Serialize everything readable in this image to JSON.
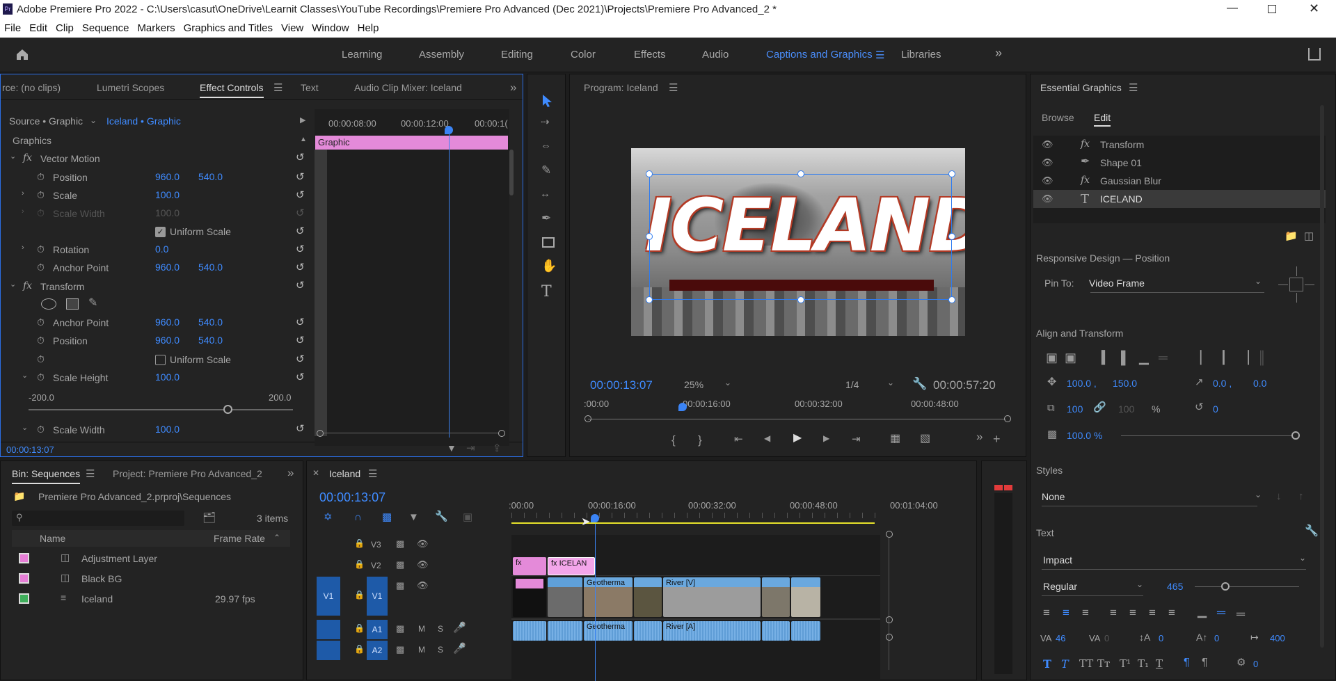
{
  "window": {
    "title": "Adobe Premiere Pro 2022 - C:\\Users\\casut\\OneDrive\\Learnit Classes\\YouTube Recordings\\Premiere Pro Advanced (Dec 2021)\\Projects\\Premiere Pro Advanced_2 *",
    "app_icon": "Pr"
  },
  "menu": [
    "File",
    "Edit",
    "Clip",
    "Sequence",
    "Markers",
    "Graphics and Titles",
    "View",
    "Window",
    "Help"
  ],
  "workspaces": [
    "Learning",
    "Assembly",
    "Editing",
    "Color",
    "Effects",
    "Audio",
    "Captions and Graphics",
    "Libraries"
  ],
  "active_workspace": "Captions and Graphics",
  "effect_panel": {
    "tabs": [
      "rce: (no clips)",
      "Lumetri Scopes",
      "Effect Controls",
      "Text",
      "Audio Clip Mixer: Iceland"
    ],
    "source": "Source • Graphic",
    "target": "Iceland • Graphic",
    "section": "Graphics",
    "tc_ruler": [
      "00:00:08:00",
      "00:00:12:00",
      "00:00:1("
    ],
    "clip_label": "Graphic",
    "vector_motion": "Vector Motion",
    "rows": [
      {
        "label": "Position",
        "v1": "960.0",
        "v2": "540.0"
      },
      {
        "label": "Scale",
        "v1": "100.0"
      },
      {
        "label": "Scale Width",
        "v1": "100.0"
      },
      {
        "label": "Uniform Scale"
      },
      {
        "label": "Rotation",
        "v1": "0.0"
      },
      {
        "label": "Anchor Point",
        "v1": "960.0",
        "v2": "540.0"
      }
    ],
    "transform": "Transform",
    "t_rows": [
      {
        "label": "Anchor Point",
        "v1": "960.0",
        "v2": "540.0"
      },
      {
        "label": "Position",
        "v1": "960.0",
        "v2": "540.0"
      },
      {
        "label": "Uniform Scale"
      },
      {
        "label": "Scale Height",
        "v1": "100.0"
      },
      {
        "label": "Scale Width",
        "v1": "100.0"
      }
    ],
    "slider_min": "-200.0",
    "slider_max": "200.0",
    "timecode": "00:00:13:07"
  },
  "program": {
    "title": "Program: Iceland",
    "headline": "ICELAND",
    "timecode": "00:00:13:07",
    "zoom": "25%",
    "quality": "1/4",
    "duration": "00:00:57:20",
    "ruler": [
      ":00:00",
      "00:00:16:00",
      "00:00:32:00",
      "00:00:48:00"
    ]
  },
  "tools": [
    "selection",
    "track-select",
    "ripple-edit",
    "razor",
    "slip",
    "pen",
    "rectangle",
    "hand",
    "type"
  ],
  "essential": {
    "title": "Essential Graphics",
    "tabs": [
      "Browse",
      "Edit"
    ],
    "layers": [
      "Transform",
      "Shape 01",
      "Gaussian Blur",
      "ICELAND"
    ],
    "responsive": "Responsive Design — Position",
    "pin_label": "Pin To:",
    "pin_value": "Video Frame",
    "align_title": "Align and Transform",
    "pos_x": "100.0 ,",
    "pos_y": "150.0",
    "anchor_x": "0.0 ,",
    "anchor_y": "0.0",
    "scale": "100",
    "scale2": "100",
    "pct": "%",
    "rotation": "0",
    "opacity": "100.0 %",
    "styles_title": "Styles",
    "style_value": "None",
    "text_title": "Text",
    "font": "Impact",
    "font_style": "Regular",
    "font_size": "465",
    "kerning": "46",
    "tracking": "0",
    "leading": "0",
    "baseline": "0",
    "tsume": "400",
    "tab_width": "0"
  },
  "project": {
    "tabs": [
      "Bin: Sequences",
      "Project: Premiere Pro Advanced_2"
    ],
    "path": "Premiere Pro Advanced_2.prproj\\Sequences",
    "count": "3 items",
    "headers": [
      "Name",
      "Frame Rate"
    ],
    "items": [
      {
        "name": "Adjustment Layer",
        "rate": "",
        "color": "#e67ed6"
      },
      {
        "name": "Black BG",
        "rate": "",
        "color": "#e67ed6"
      },
      {
        "name": "Iceland",
        "rate": "29.97 fps",
        "color": "#3fae5b"
      }
    ]
  },
  "timeline": {
    "tab": "Iceland",
    "timecode": "00:00:13:07",
    "ruler": [
      ":00:00",
      "00:00:16:00",
      "00:00:32:00",
      "00:00:48:00",
      "00:01:04:00"
    ],
    "tracks": [
      "V3",
      "V2",
      "V1",
      "A1",
      "A2"
    ],
    "src_v1": "V1",
    "src_a1": "A1",
    "src_a2": "A2",
    "clips": {
      "v2_title": "ICELAN",
      "v1_a": "Geotherma",
      "v1_b": "River [V]",
      "a1_a": "Geotherma",
      "a1_b": "River [A]"
    },
    "m": "M",
    "s": "S"
  }
}
